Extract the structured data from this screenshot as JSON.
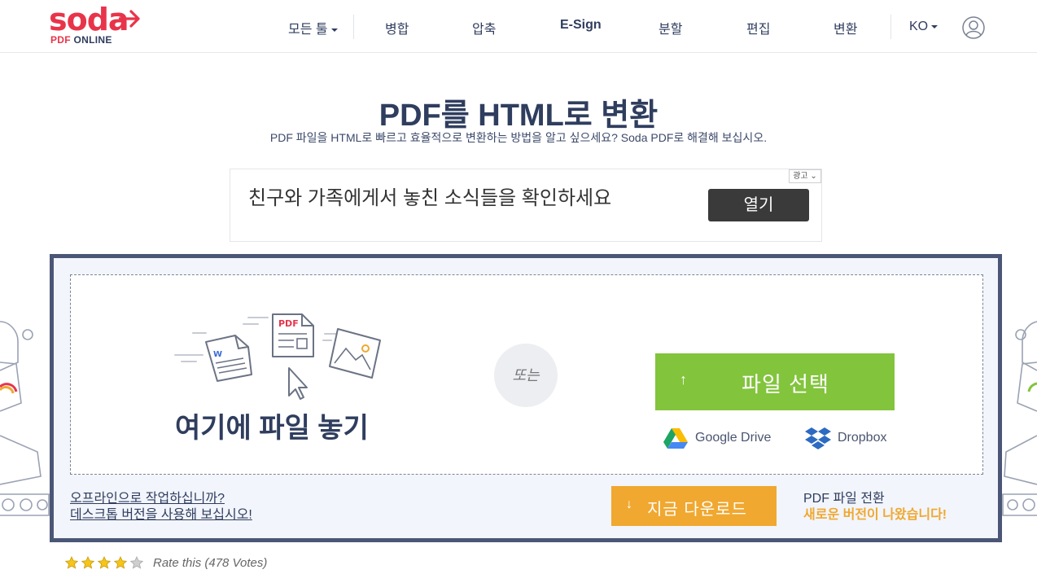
{
  "header": {
    "logo_word": "soda",
    "logo_sub_pdf": "PDF",
    "logo_sub_online": "ONLINE",
    "nav": {
      "all_tools": "모든 툴",
      "merge": "병합",
      "compress": "압축",
      "esign": "E-Sign",
      "split": "분할",
      "edit": "편집",
      "convert": "변환"
    },
    "lang": "KO"
  },
  "main": {
    "title": "PDF를 HTML로 변환",
    "subtitle": "PDF 파일을 HTML로 빠르고 효율적으로 변환하는 방법을 알고 싶으세요? Soda PDF로 해결해 보십시오."
  },
  "ad": {
    "text": "친구와 가족에게서 놓친 소식들을 확인하세요",
    "button": "열기",
    "badge": "광고"
  },
  "upload": {
    "drop_text": "여기에 파일 놓기",
    "or_text": "또는",
    "choose_file": "파일 선택",
    "choose_arrow": "↑",
    "google_drive": "Google Drive",
    "dropbox": "Dropbox",
    "offline_line1": "오프라인으로 작업하십니까?",
    "offline_line2": "데스크톱 버전을 사용해 보십시오!",
    "download_arrow": "↓",
    "download_now": "지금 다운로드",
    "newver_line1": "PDF 파일 전환",
    "newver_line2": "새로운 버전이 나왔습니다!"
  },
  "rating": {
    "text": "Rate this (478 Votes)",
    "stars_filled": 4,
    "stars_total": 5
  },
  "colors": {
    "brand_red": "#e8344a",
    "navy": "#2f3d5e",
    "green": "#82c43c",
    "orange": "#f0a830",
    "box_border": "#4b5677"
  },
  "icons": [
    "user-icon",
    "word-doc-icon",
    "pdf-doc-icon",
    "image-doc-icon",
    "cursor-icon",
    "google-drive-icon",
    "dropbox-icon",
    "star-icon"
  ]
}
